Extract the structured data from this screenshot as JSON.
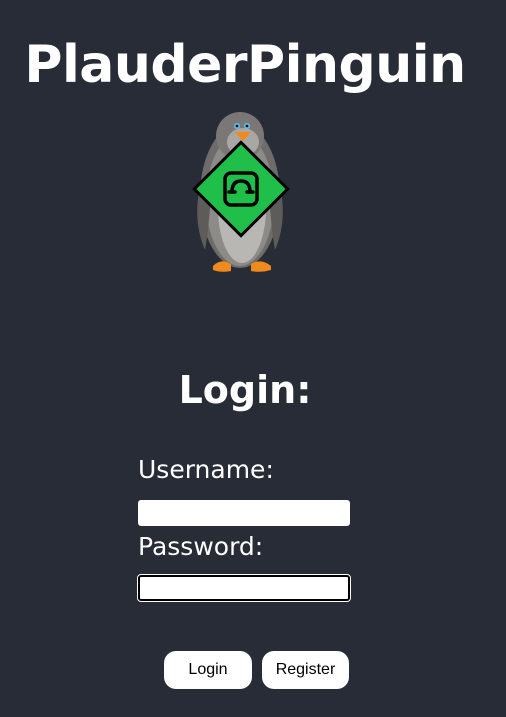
{
  "app": {
    "title": "PlauderPinguin"
  },
  "login_form": {
    "heading": "Login:",
    "username_label": "Username:",
    "username_value": "",
    "password_label": "Password:",
    "password_value": "",
    "login_button": "Login",
    "register_button": "Register"
  },
  "logo": {
    "icon": "penguin-with-hangup-phone-sign",
    "sign_color": "#1fbf4a"
  },
  "colors": {
    "background": "#282c36",
    "text": "#ffffff",
    "button_bg": "#ffffff"
  }
}
